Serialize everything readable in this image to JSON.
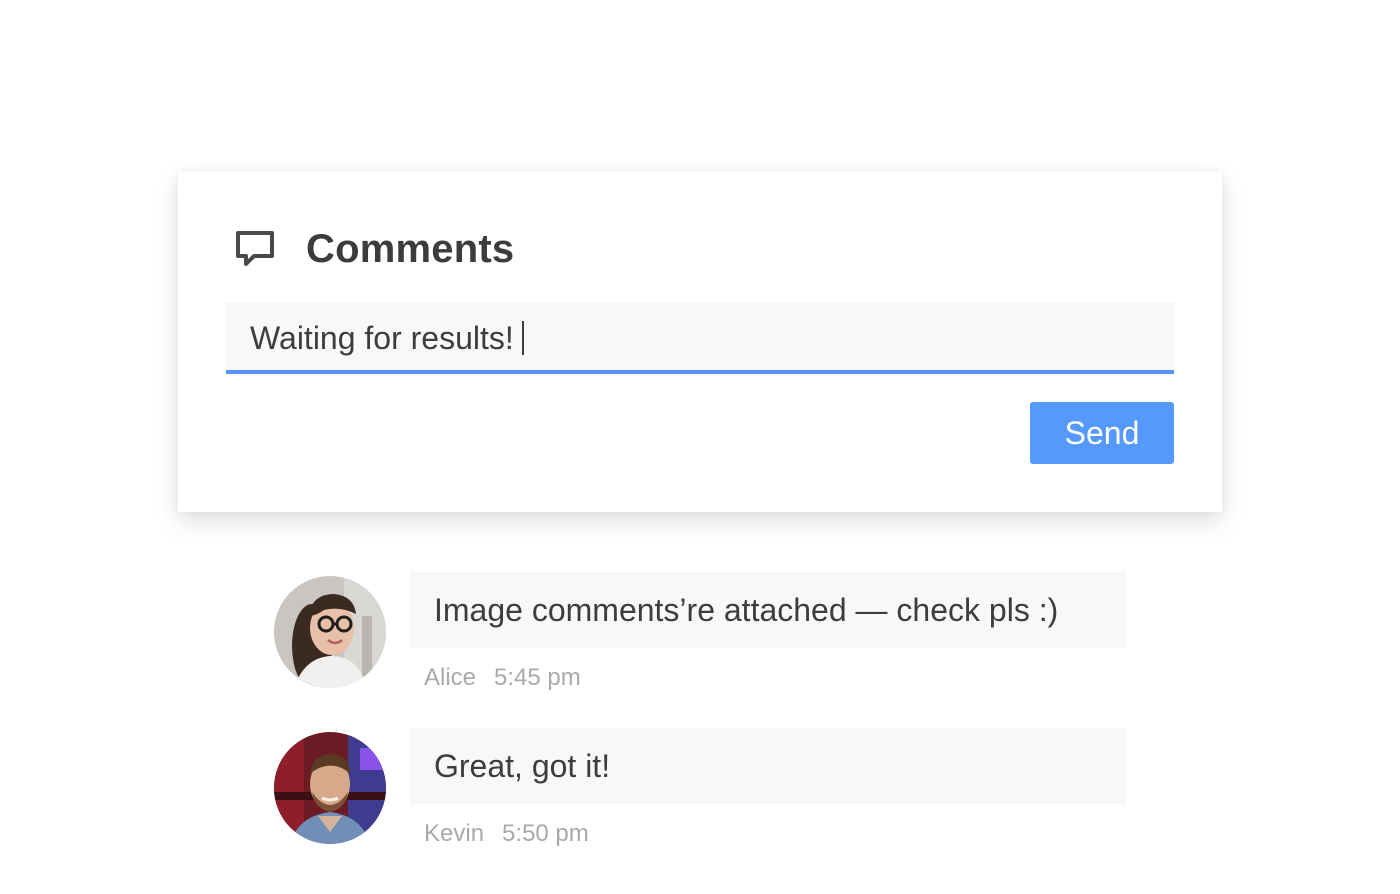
{
  "panel": {
    "title": "Comments",
    "icon": "comment-icon"
  },
  "input": {
    "value": "Waiting for results!",
    "accent_color": "#5593f2"
  },
  "send_button": {
    "label": "Send",
    "color": "#5499fb"
  },
  "comments": [
    {
      "text": "Image comments’re attached — check pls :)",
      "author": "Alice",
      "time": "5:45 pm"
    },
    {
      "text": "Great, got it!",
      "author": "Kevin",
      "time": "5:50 pm"
    }
  ]
}
